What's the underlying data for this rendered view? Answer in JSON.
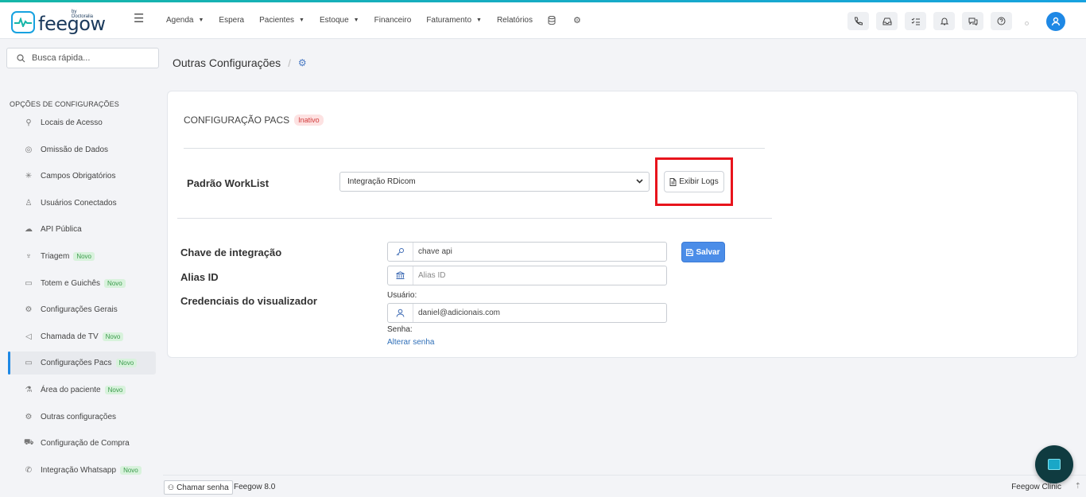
{
  "brand": {
    "name": "feegow",
    "by": "by Doctoralia"
  },
  "nav": [
    {
      "label": "Agenda",
      "caret": true
    },
    {
      "label": "Espera",
      "caret": false
    },
    {
      "label": "Pacientes",
      "caret": true
    },
    {
      "label": "Estoque",
      "caret": true
    },
    {
      "label": "Financeiro",
      "caret": false
    },
    {
      "label": "Faturamento",
      "caret": true
    },
    {
      "label": "Relatórios",
      "caret": false
    }
  ],
  "search": {
    "placeholder": "Busca rápida..."
  },
  "sidebar": {
    "title": "OPÇÕES DE CONFIGURAÇÕES",
    "items": [
      {
        "label": "Locais de Acesso",
        "icon": "location-icon",
        "new": false
      },
      {
        "label": "Omissão de Dados",
        "icon": "eye-off-icon",
        "new": false
      },
      {
        "label": "Campos Obrigatórios",
        "icon": "asterisk-icon",
        "new": false
      },
      {
        "label": "Usuários Conectados",
        "icon": "user-icon",
        "new": false
      },
      {
        "label": "API Pública",
        "icon": "cloud-upload-icon",
        "new": false
      },
      {
        "label": "Triagem",
        "icon": "stethoscope-icon",
        "new": true
      },
      {
        "label": "Totem e Guichês",
        "icon": "laptop-icon",
        "new": true
      },
      {
        "label": "Configurações Gerais",
        "icon": "gears-icon",
        "new": false
      },
      {
        "label": "Chamada de TV",
        "icon": "megaphone-icon",
        "new": true
      },
      {
        "label": "Configurações Pacs",
        "icon": "laptop-icon",
        "new": true
      },
      {
        "label": "Área do paciente",
        "icon": "flask-icon",
        "new": true
      },
      {
        "label": "Outras configurações",
        "icon": "gears-icon",
        "new": false
      },
      {
        "label": "Configuração de Compra",
        "icon": "cart-icon",
        "new": false
      },
      {
        "label": "Integração Whatsapp",
        "icon": "whatsapp-icon",
        "new": true
      }
    ],
    "new_badge": "Novo"
  },
  "breadcrumb": {
    "title": "Outras Configurações",
    "separator": "/"
  },
  "card": {
    "title": "CONFIGURAÇÃO PACS",
    "status": "Inativo",
    "worklist_label": "Padrão WorkList",
    "worklist_value": "Integração RDicom",
    "logs_button": "Exibir Logs",
    "chave_label": "Chave de integração",
    "chave_value": "chave api",
    "alias_label": "Alias ID",
    "alias_placeholder": "Alias ID",
    "cred_label": "Credenciais do visualizador",
    "usuario_label": "Usuário:",
    "usuario_value": "daniel@adicionais.com",
    "senha_label": "Senha:",
    "alterar_senha": "Alterar senha",
    "save_button": "Salvar"
  },
  "footer": {
    "chamar": "Chamar senha",
    "version": "Feegow 8.0",
    "clinic": "Feegow Clinic"
  },
  "colors": {
    "accent": "#1e88e5",
    "highlight": "#e8141c",
    "save": "#4b8de8",
    "inactive": "#d23c3c"
  }
}
